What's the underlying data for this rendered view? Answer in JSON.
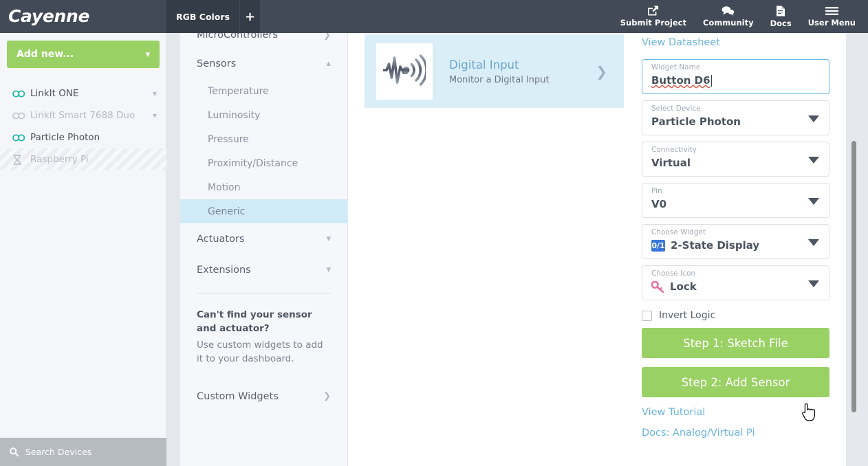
{
  "header": {
    "brand": "Cayenne",
    "tabs": [
      {
        "label": "RGB Colors",
        "active": true
      }
    ],
    "add_tab_label": "+",
    "actions": [
      {
        "label": "Submit Project",
        "icon": "share-icon"
      },
      {
        "label": "Community",
        "icon": "chat-icon"
      },
      {
        "label": "Docs",
        "icon": "document-icon"
      },
      {
        "label": "User Menu",
        "icon": "hamburger-icon"
      }
    ]
  },
  "sidebar": {
    "add_new_label": "Add new...",
    "devices": [
      {
        "label": "LinkIt ONE",
        "state": "on",
        "caret": true
      },
      {
        "label": "LinkIt Smart 7688 Duo",
        "state": "off",
        "caret": true
      },
      {
        "label": "Particle Photon",
        "state": "on",
        "caret": false
      },
      {
        "label": "Raspberry Pi",
        "state": "pending",
        "caret": false
      }
    ],
    "search_placeholder": "Search Devices"
  },
  "menu": {
    "groups": [
      {
        "label": "MicroControllers",
        "expanded": false
      },
      {
        "label": "Sensors",
        "expanded": true
      }
    ],
    "sensors": [
      {
        "label": "Temperature",
        "active": false
      },
      {
        "label": "Luminosity",
        "active": false
      },
      {
        "label": "Pressure",
        "active": false
      },
      {
        "label": "Proximity/Distance",
        "active": false
      },
      {
        "label": "Motion",
        "active": false
      },
      {
        "label": "Generic",
        "active": true
      }
    ],
    "groups_after": [
      {
        "label": "Actuators",
        "expanded": false
      },
      {
        "label": "Extensions",
        "expanded": false
      }
    ],
    "help_title": "Can't find your sensor and actuator?",
    "help_body": "Use custom widgets to add it to your dashboard.",
    "custom_widgets_label": "Custom Widgets"
  },
  "center": {
    "card": {
      "title": "Digital Input",
      "subtitle": "Monitor a Digital Input",
      "icon": "signal-waveform-icon"
    }
  },
  "form": {
    "datasheet_link": "View Datasheet",
    "widget_name": {
      "label": "Widget Name",
      "value": "Button D6"
    },
    "select_device": {
      "label": "Select Device",
      "value": "Particle Photon"
    },
    "connectivity": {
      "label": "Connectivity",
      "value": "Virtual"
    },
    "pin": {
      "label": "Pin",
      "value": "V0"
    },
    "choose_widget": {
      "label": "Choose Widget",
      "value": "2-State Display",
      "badge": "0/1"
    },
    "choose_icon": {
      "label": "Choose Icon",
      "value": "Lock",
      "icon": "key-icon"
    },
    "invert_logic": {
      "label": "Invert Logic",
      "checked": false
    },
    "step1_label": "Step 1: Sketch File",
    "step2_label": "Step 2: Add Sensor",
    "tutorial_link": "View Tutorial",
    "docs_link": "Docs: Analog/Virtual Pi"
  },
  "colors": {
    "header_bg": "#414a56",
    "tab_bg": "#343c48",
    "accent_green": "#9ad164",
    "accent_blue": "#6cb4de",
    "card_bg": "#daeef8",
    "active_item": "#d0ebf7",
    "badge_blue": "#3b77d8",
    "key_pink": "#e673a8"
  }
}
